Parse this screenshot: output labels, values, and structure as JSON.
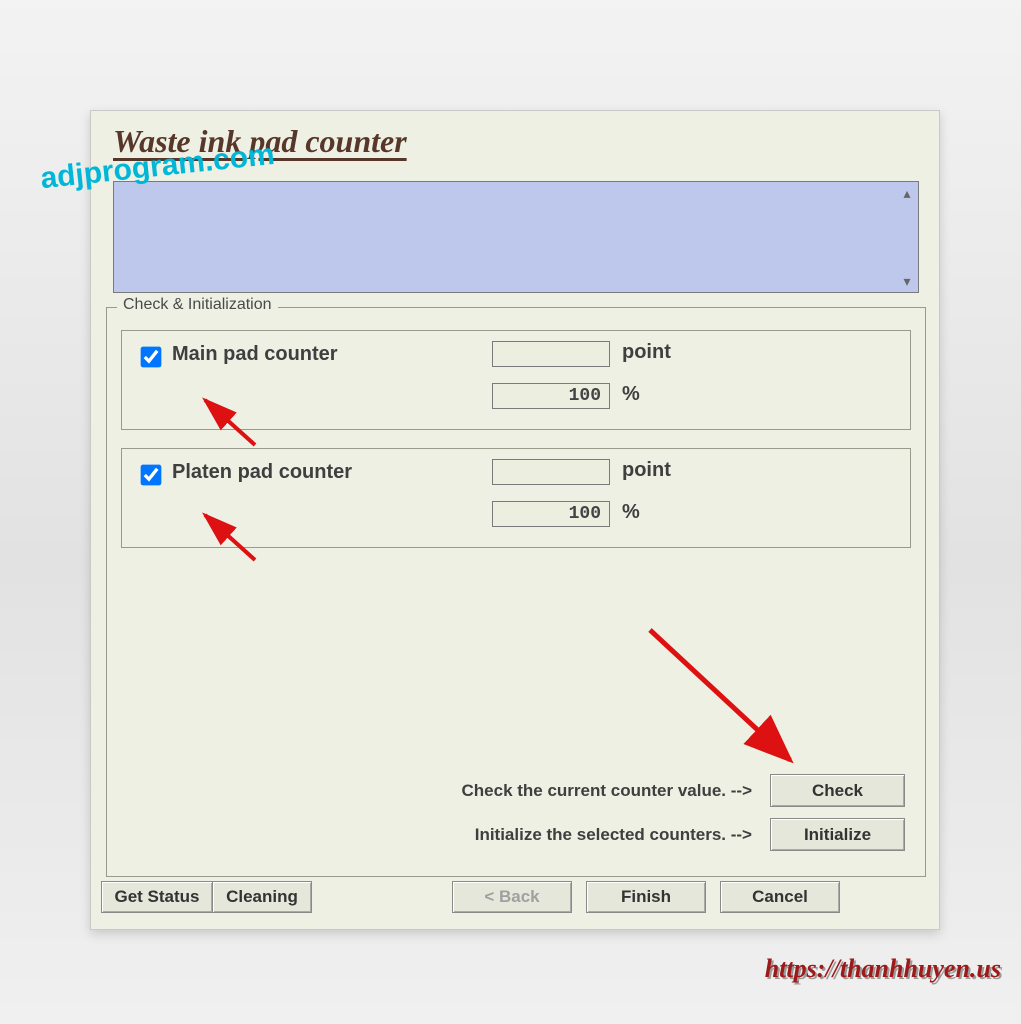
{
  "title": "Waste ink pad counter",
  "watermark1": "adjprogram.com",
  "watermark2": "https://thanhhuyen.us",
  "group": {
    "legend": "Check & Initialization",
    "main": {
      "label": "Main pad counter",
      "checked": true,
      "points": "",
      "percent": "100",
      "unit_points": "point",
      "unit_percent": "%"
    },
    "platen": {
      "label": "Platen pad counter",
      "checked": true,
      "points": "",
      "percent": "100",
      "unit_points": "point",
      "unit_percent": "%"
    },
    "hint_check": "Check the current counter value. -->",
    "hint_init": "Initialize the selected counters. -->",
    "btn_check": "Check",
    "btn_init": "Initialize"
  },
  "buttons": {
    "get_status": "Get Status",
    "cleaning": "Cleaning",
    "back": "< Back",
    "finish": "Finish",
    "cancel": "Cancel"
  }
}
